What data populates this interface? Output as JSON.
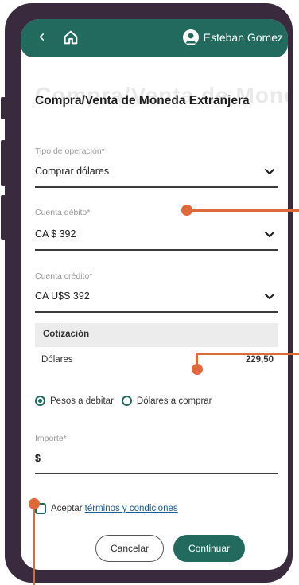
{
  "header": {
    "back_icon": "chevron-left-icon",
    "home_icon": "home-icon",
    "user_icon": "user-circle-icon",
    "user_name": "Esteban Gomez"
  },
  "page": {
    "title": "Compra/Venta de Moneda Extranjera"
  },
  "form": {
    "operation_type": {
      "label": "Tipo de operación*",
      "value": "Comprar dólares"
    },
    "debit_account": {
      "label": "Cuenta débito*",
      "value": "CA $ 392 |"
    },
    "credit_account": {
      "label": "Cuenta crédito*",
      "value": "CA U$S 392"
    },
    "rate": {
      "header": "Cotización",
      "currency": "Dólares",
      "value": "229,50"
    },
    "radio_options": [
      {
        "label": "Pesos a debitar",
        "selected": true
      },
      {
        "label": "Dólares a comprar",
        "selected": false
      }
    ],
    "amount": {
      "label": "Importe*",
      "value": "$"
    },
    "terms": {
      "prefix": "Aceptar",
      "link": "términos y condiciones",
      "checked": false
    }
  },
  "buttons": {
    "cancel": "Cancelar",
    "continue": "Continuar"
  },
  "colors": {
    "primary": "#22695e",
    "callout": "#e0683a",
    "phone_frame": "#3a2a3d",
    "link": "#1c5c94"
  }
}
